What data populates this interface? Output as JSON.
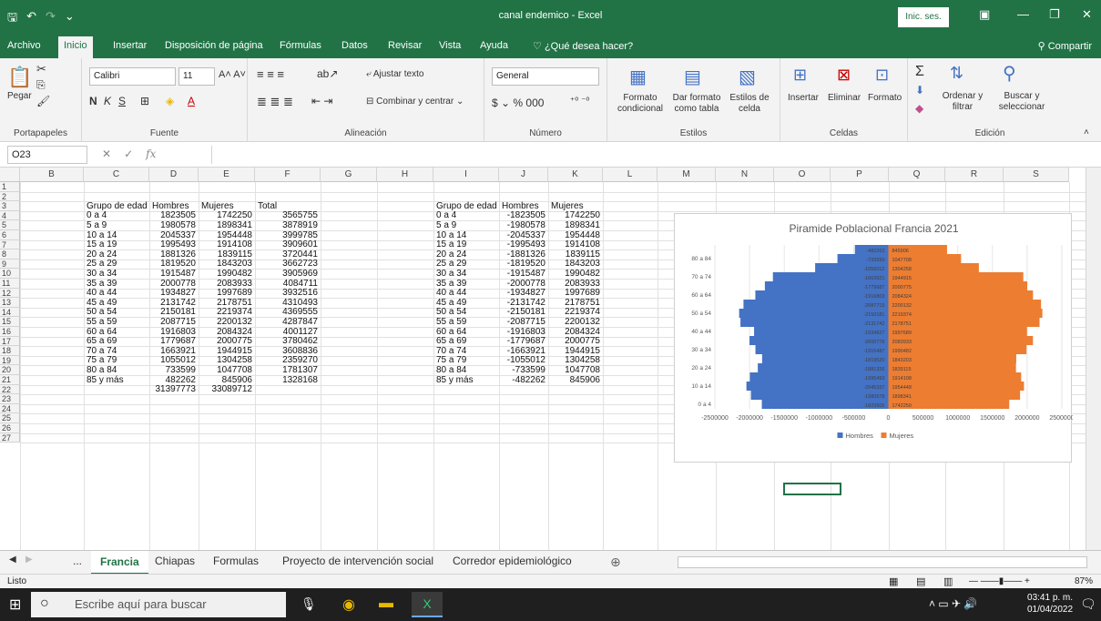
{
  "window": {
    "title": "canal endemico  -  Excel",
    "signin": "Inic. ses."
  },
  "ribbon_tabs": [
    "Archivo",
    "Inicio",
    "Insertar",
    "Disposición de página",
    "Fórmulas",
    "Datos",
    "Revisar",
    "Vista",
    "Ayuda",
    "¿Qué desea hacer?"
  ],
  "share": "Compartir",
  "ribbon": {
    "paste": "Pegar",
    "clipboard_label": "Portapapeles",
    "font_name": "Calibri",
    "font_size": "11",
    "font_label": "Fuente",
    "wrap": "Ajustar texto",
    "merge": "Combinar y centrar",
    "align_label": "Alineación",
    "number_format": "General",
    "number_label": "Número",
    "cond_format": "Formato condicional",
    "format_table": "Dar formato como tabla",
    "cell_styles": "Estilos de celda",
    "styles_label": "Estilos",
    "insert": "Insertar",
    "delete": "Eliminar",
    "format": "Formato",
    "cells_label": "Celdas",
    "sort": "Ordenar y filtrar",
    "find": "Buscar y seleccionar",
    "edit_label": "Edición"
  },
  "formula_bar": {
    "name_box": "O23",
    "value": ""
  },
  "columns": [
    "B",
    "C",
    "D",
    "E",
    "F",
    "G",
    "H",
    "I",
    "J",
    "K",
    "L",
    "M",
    "N",
    "O",
    "P",
    "Q",
    "R",
    "S"
  ],
  "rows": [
    "1",
    "2",
    "3",
    "4",
    "5",
    "6",
    "7",
    "8",
    "9",
    "10",
    "11",
    "12",
    "13",
    "14",
    "15",
    "16",
    "17",
    "18",
    "19",
    "20",
    "21",
    "22",
    "23",
    "24",
    "25",
    "26",
    "27"
  ],
  "table1": {
    "headers": [
      "Grupo de edad",
      "Hombres",
      "Mujeres",
      "Total"
    ],
    "rows": [
      [
        "0 a 4",
        "1823505",
        "1742250",
        "3565755"
      ],
      [
        "5 a 9",
        "1980578",
        "1898341",
        "3878919"
      ],
      [
        "10 a 14",
        "2045337",
        "1954448",
        "3999785"
      ],
      [
        "15 a 19",
        "1995493",
        "1914108",
        "3909601"
      ],
      [
        "20 a 24",
        "1881326",
        "1839115",
        "3720441"
      ],
      [
        "25 a 29",
        "1819520",
        "1843203",
        "3662723"
      ],
      [
        "30 a 34",
        "1915487",
        "1990482",
        "3905969"
      ],
      [
        "35 a 39",
        "2000778",
        "2083933",
        "4084711"
      ],
      [
        "40 a 44",
        "1934827",
        "1997689",
        "3932516"
      ],
      [
        "45 a 49",
        "2131742",
        "2178751",
        "4310493"
      ],
      [
        "50 a 54",
        "2150181",
        "2219374",
        "4369555"
      ],
      [
        "55 a 59",
        "2087715",
        "2200132",
        "4287847"
      ],
      [
        "60 a 64",
        "1916803",
        "2084324",
        "4001127"
      ],
      [
        "65 a 69",
        "1779687",
        "2000775",
        "3780462"
      ],
      [
        "70 a 74",
        "1663921",
        "1944915",
        "3608836"
      ],
      [
        "75 a 79",
        "1055012",
        "1304258",
        "2359270"
      ],
      [
        "80 a 84",
        "733599",
        "1047708",
        "1781307"
      ],
      [
        "85 y más",
        "482262",
        "845906",
        "1328168"
      ]
    ],
    "totals": [
      "",
      "31397773",
      "33089712",
      ""
    ]
  },
  "table2": {
    "headers": [
      "Grupo de edad",
      "Hombres",
      "Mujeres"
    ],
    "rows": [
      [
        "0 a 4",
        "-1823505",
        "1742250"
      ],
      [
        "5 a 9",
        "-1980578",
        "1898341"
      ],
      [
        "10 a 14",
        "-2045337",
        "1954448"
      ],
      [
        "15 a 19",
        "-1995493",
        "1914108"
      ],
      [
        "20 a 24",
        "-1881326",
        "1839115"
      ],
      [
        "25 a 29",
        "-1819520",
        "1843203"
      ],
      [
        "30 a 34",
        "-1915487",
        "1990482"
      ],
      [
        "35 a 39",
        "-2000778",
        "2083933"
      ],
      [
        "40 a 44",
        "-1934827",
        "1997689"
      ],
      [
        "45 a 49",
        "-2131742",
        "2178751"
      ],
      [
        "50 a 54",
        "-2150181",
        "2219374"
      ],
      [
        "55 a 59",
        "-2087715",
        "2200132"
      ],
      [
        "60 a 64",
        "-1916803",
        "2084324"
      ],
      [
        "65 a 69",
        "-1779687",
        "2000775"
      ],
      [
        "70 a 74",
        "-1663921",
        "1944915"
      ],
      [
        "75 a 79",
        "-1055012",
        "1304258"
      ],
      [
        "80 a 84",
        "-733599",
        "1047708"
      ],
      [
        "85 y más",
        "-482262",
        "845906"
      ]
    ]
  },
  "chart_data": {
    "type": "bar",
    "title": "Piramide Poblacional Francia 2021",
    "orientation": "horizontal",
    "categories": [
      "0 a 4",
      "5 a 9",
      "10 a 14",
      "15 a 19",
      "20 a 24",
      "25 a 29",
      "30 a 34",
      "35 a 39",
      "40 a 44",
      "45 a 49",
      "50 a 54",
      "55 a 59",
      "60 a 64",
      "65 a 69",
      "70 a 74",
      "75 a 79",
      "80 a 84",
      "85 y más"
    ],
    "category_ticks": [
      "0 a 4",
      "10 a 14",
      "20 a 24",
      "30 a 34",
      "40 a 44",
      "50 a 54",
      "60 a 64",
      "70 a 74",
      "80 a 84"
    ],
    "series": [
      {
        "name": "Hombres",
        "color": "#4472c4",
        "values": [
          -1823505,
          -1980578,
          -2045337,
          -1995493,
          -1881326,
          -1819520,
          -1915487,
          -2000778,
          -1934827,
          -2131742,
          -2150181,
          -2087715,
          -1916803,
          -1779687,
          -1663921,
          -1055012,
          -733599,
          -482262
        ]
      },
      {
        "name": "Mujeres",
        "color": "#ed7d31",
        "values": [
          1742250,
          1898341,
          1954448,
          1914108,
          1839115,
          1843203,
          1990482,
          2083933,
          1997689,
          2178751,
          2219374,
          2200132,
          2084324,
          2000775,
          1944915,
          1304258,
          1047708,
          845906
        ]
      }
    ],
    "x_ticks": [
      "-2500000",
      "-2000000",
      "-1500000",
      "-1000000",
      "-500000",
      "0",
      "500000",
      "1000000",
      "1500000",
      "2000000",
      "2500000"
    ],
    "xlim": [
      -2500000,
      2500000
    ],
    "legend": "bottom"
  },
  "sheet_tabs": [
    "...",
    "Francia",
    "Chiapas",
    "Formulas",
    "Proyecto de intervención social",
    "Corredor epidemiológico"
  ],
  "status": {
    "ready": "Listo",
    "zoom": "87%"
  },
  "taskbar": {
    "search": "Escribe aquí para buscar",
    "time": "03:41 p. m.",
    "date": "01/04/2022"
  }
}
